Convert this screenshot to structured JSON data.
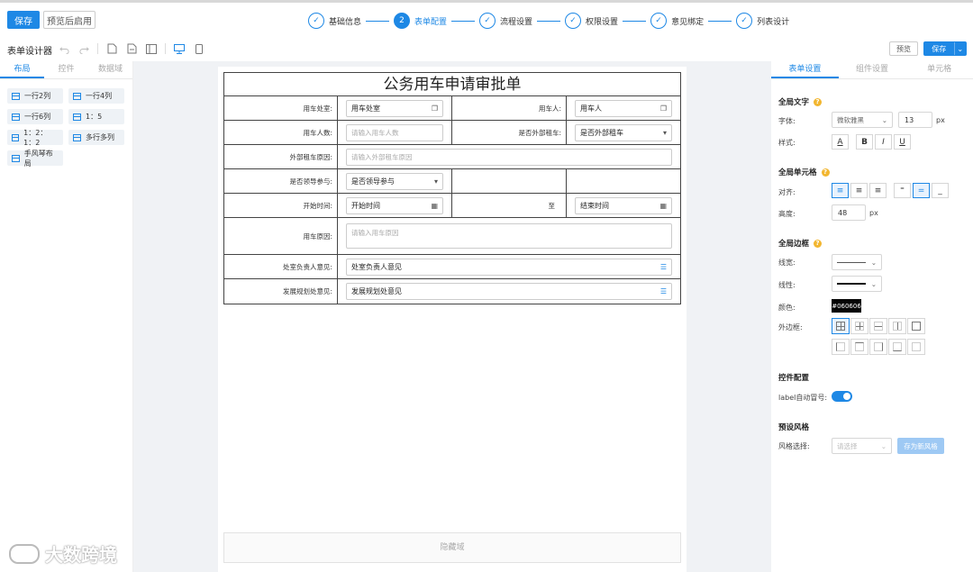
{
  "top": {
    "save_label": "保存",
    "preview_label": "预览后启用",
    "steps": [
      {
        "index": "✓",
        "label": "基础信息",
        "active": false
      },
      {
        "index": "2",
        "label": "表单配置",
        "active": true
      },
      {
        "index": "✓",
        "label": "流程设置",
        "active": false
      },
      {
        "index": "✓",
        "label": "权限设置",
        "active": false
      },
      {
        "index": "✓",
        "label": "意见绑定",
        "active": false
      },
      {
        "index": "✓",
        "label": "列表设计",
        "active": false
      }
    ]
  },
  "toolbar": {
    "title": "表单设计器",
    "preview_label": "预览",
    "save_label": "保存"
  },
  "left": {
    "tabs": [
      "布局",
      "控件",
      "数据域"
    ],
    "layouts": [
      "一行2列",
      "一行4列",
      "一行6列",
      "1：5",
      "1：2：1：2",
      "多行多列",
      "手风琴布局"
    ]
  },
  "form": {
    "title": "公务用车申请审批单",
    "dept_label": "用车处室:",
    "dept_value": "用车处室",
    "user_label": "用车人:",
    "user_value": "用车人",
    "count_label": "用车人数:",
    "count_placeholder": "请输入用车人数",
    "ext_label": "是否外部租车:",
    "ext_value": "是否外部租车",
    "ext_reason_label": "外部租车原因:",
    "ext_reason_placeholder": "请输入外部租车原因",
    "leader_label": "是否领导参与:",
    "leader_value": "是否领导参与",
    "start_label": "开始时间:",
    "start_value": "开始时间",
    "to_label": "至",
    "end_value": "结束时间",
    "reason_label": "用车原因:",
    "reason_placeholder": "请输入用车原因",
    "dept_opinion_label": "处室负责人意见:",
    "dept_opinion_value": "处室负责人意见",
    "plan_opinion_label": "发展规划处意见:",
    "plan_opinion_value": "发展规划处意见"
  },
  "hidden_area": "隐藏域",
  "right": {
    "tabs": [
      "表单设置",
      "组件设置",
      "单元格"
    ],
    "global_text": "全局文字",
    "font_label": "字体:",
    "font_value": "微软雅黑",
    "font_size": "13",
    "unit_px": "px",
    "style_label": "样式:",
    "style_buttons": [
      "A",
      "B",
      "I",
      "U"
    ],
    "global_cell": "全局单元格",
    "align_label": "对齐:",
    "height_label": "高度:",
    "height_value": "48",
    "global_border": "全局边框",
    "line_width_label": "线宽:",
    "line_style_label": "线性:",
    "color_label": "颜色:",
    "color_value": "#060606",
    "outer_label": "外边框:",
    "control_config": "控件配置",
    "auto_colon_label": "label自动冒号:",
    "preset_style": "预设风格",
    "style_select_label": "风格选择:",
    "style_select_placeholder": "请选择",
    "save_style_label": "存为新风格"
  },
  "watermark": "大数跨境",
  "colors": {
    "accent": "#1e88e5",
    "border": "#444444"
  }
}
